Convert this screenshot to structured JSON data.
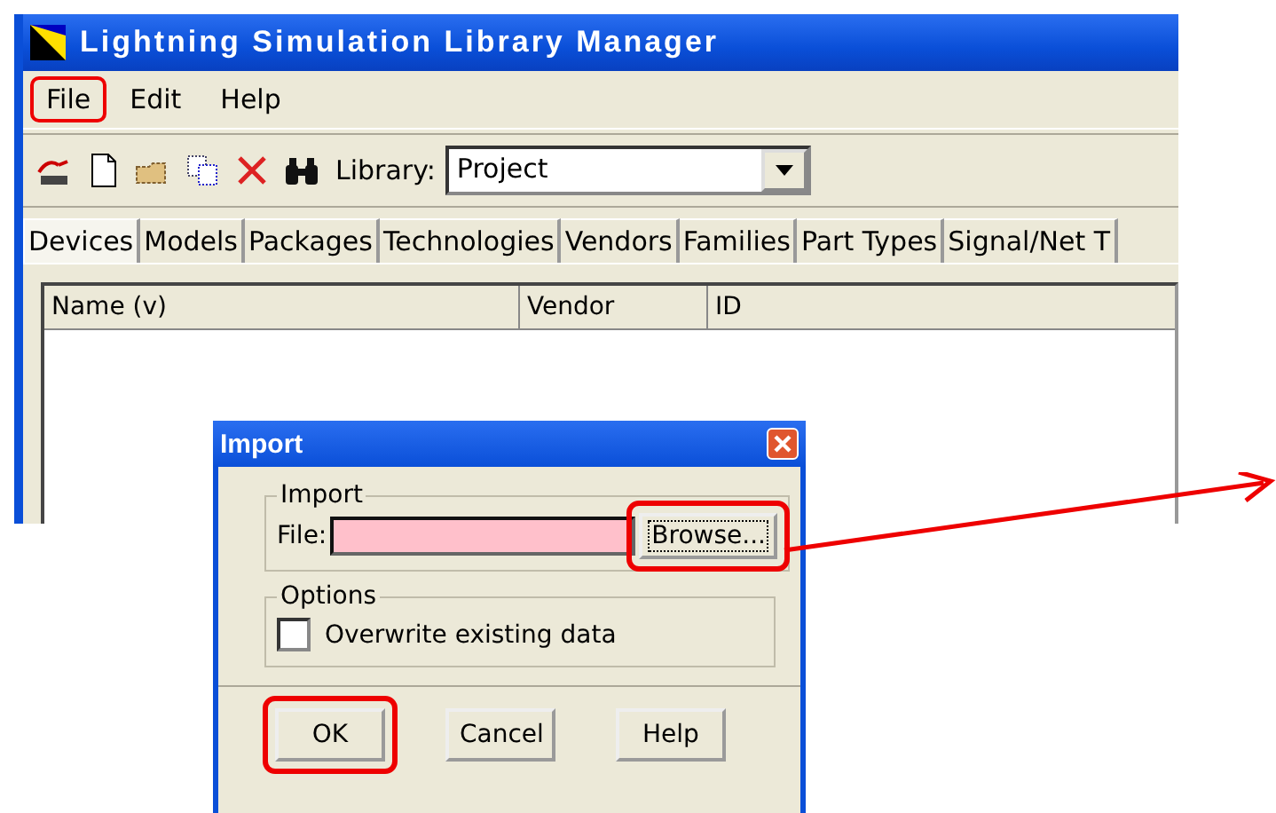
{
  "window": {
    "title": "Lightning Simulation Library Manager"
  },
  "menu": [
    {
      "label": "File",
      "highlighted": true
    },
    {
      "label": "Edit",
      "highlighted": false
    },
    {
      "label": "Help",
      "highlighted": false
    }
  ],
  "toolbar": {
    "library_label": "Library:",
    "library_value": "Project"
  },
  "tabs": [
    {
      "label": "Devices",
      "selected": true
    },
    {
      "label": "Models",
      "selected": false
    },
    {
      "label": "Packages",
      "selected": false
    },
    {
      "label": "Technologies",
      "selected": false
    },
    {
      "label": "Vendors",
      "selected": false
    },
    {
      "label": "Families",
      "selected": false
    },
    {
      "label": "Part Types",
      "selected": false
    },
    {
      "label": "Signal/Net T",
      "selected": false
    }
  ],
  "table": {
    "columns": [
      "Name (v)",
      "Vendor",
      "ID"
    ]
  },
  "dialog": {
    "title": "Import",
    "import_group": "Import",
    "file_label": "File:",
    "browse": {
      "label": "Browse...",
      "highlighted": true
    },
    "options_group": "Options",
    "overwrite": {
      "label": "Overwrite existing data",
      "checked": false
    },
    "buttons": [
      {
        "label": "OK",
        "highlighted": true
      },
      {
        "label": "Cancel",
        "highlighted": false
      },
      {
        "label": "Help",
        "highlighted": false
      }
    ]
  }
}
